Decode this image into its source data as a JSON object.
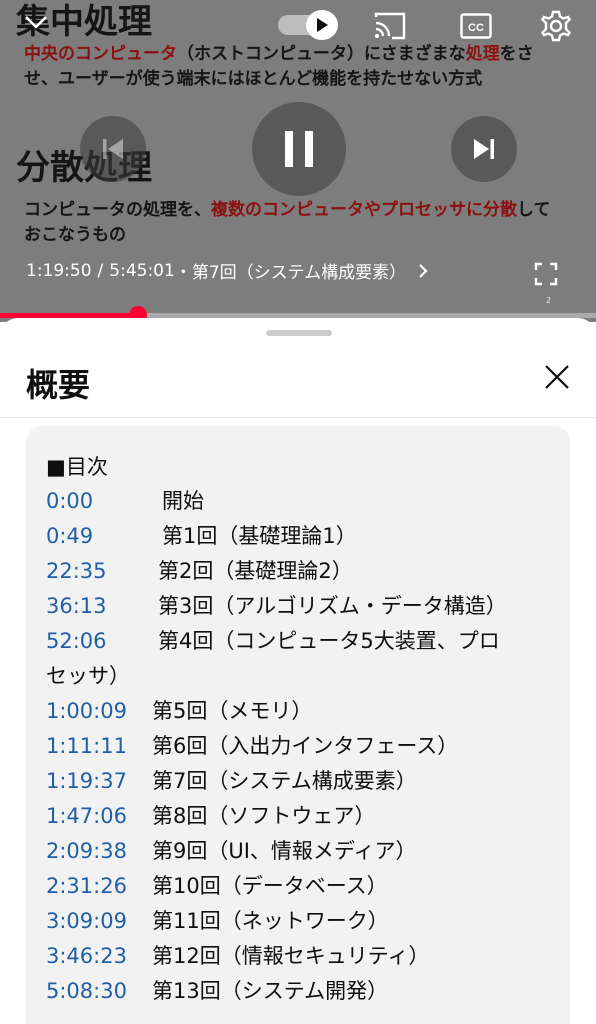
{
  "slide": {
    "heading1": "集中処理",
    "para1_red_a": "中央のコンピュータ",
    "para1_black_a": "（ホストコンピュータ）にさまざまな",
    "para1_red_b": "処理",
    "para1_black_b": "をさせ、ユーザーが使う端末にはほとんど機能を持たせない方式",
    "heading2": "分散処理",
    "para2_black_a": "コンピュータの処理を、",
    "para2_red_a": "複数のコンピュータやプロセッサに分散",
    "para2_black_b": "しておこなうもの"
  },
  "player": {
    "current_time": "1:19:50",
    "separator": "/",
    "duration": "5:45:01",
    "chapter": "・第7回（システム構成要素）",
    "tiny_label": "2",
    "progress_fraction": 0.2313,
    "accent_color": "#ff0033",
    "icons": [
      "chevron-down-icon",
      "autoplay-toggle",
      "cast-icon",
      "cc-icon",
      "settings-icon",
      "previous-icon",
      "pause-icon",
      "next-icon",
      "fullscreen-icon"
    ]
  },
  "sheet": {
    "title": "概要",
    "toc_heading": "■目次",
    "toc": [
      {
        "ts": "0:00",
        "label": "開始"
      },
      {
        "ts": "0:49",
        "label": "第1回（基礎理論1）"
      },
      {
        "ts": "22:35",
        "label": "第2回（基礎理論2）"
      },
      {
        "ts": "36:13",
        "label": "第3回（アルゴリズム・データ構造）"
      },
      {
        "ts": "52:06",
        "label": "第4回（コンピュータ5大装置、プロ",
        "cont": "セッサ）"
      },
      {
        "ts": "1:00:09",
        "label": "第5回（メモリ）"
      },
      {
        "ts": "1:11:11",
        "label": "第6回（入出力インタフェース）"
      },
      {
        "ts": "1:19:37",
        "label": "第7回（システム構成要素）"
      },
      {
        "ts": "1:47:06",
        "label": "第8回（ソフトウェア）"
      },
      {
        "ts": "2:09:38",
        "label": "第9回（UI、情報メディア）"
      },
      {
        "ts": "2:31:26",
        "label": "第10回（データベース）"
      },
      {
        "ts": "3:09:09",
        "label": "第11回（ネットワーク）"
      },
      {
        "ts": "3:46:23",
        "label": "第12回（情報セキュリティ）"
      },
      {
        "ts": "5:08:30",
        "label": "第13回（システム開発）"
      }
    ],
    "link_color": "#1f5fa8"
  }
}
